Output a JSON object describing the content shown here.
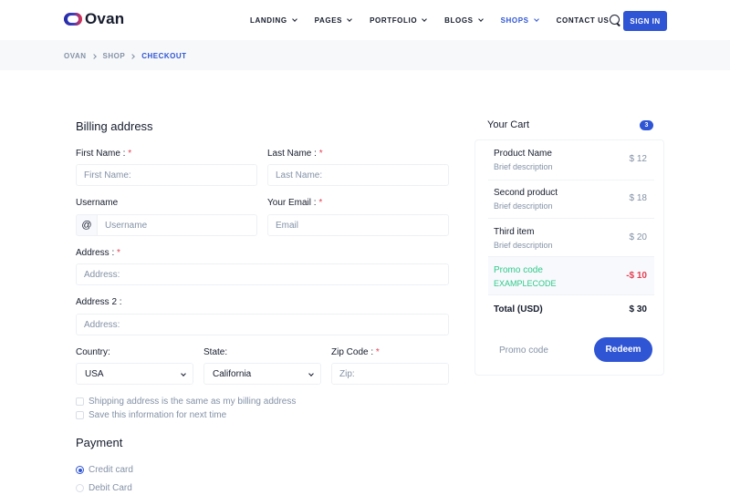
{
  "header": {
    "logo_text": "Ovan",
    "nav": [
      {
        "label": "LANDING",
        "dropdown": true
      },
      {
        "label": "PAGES",
        "dropdown": true
      },
      {
        "label": "PORTFOLIO",
        "dropdown": true
      },
      {
        "label": "BLOGS",
        "dropdown": true
      },
      {
        "label": "SHOPS",
        "dropdown": true,
        "active": true
      },
      {
        "label": "CONTACT US",
        "dropdown": false
      }
    ],
    "signin_label": "SIGN IN"
  },
  "breadcrumb": [
    "OVAN",
    "SHOP",
    "CHECKOUT"
  ],
  "billing": {
    "title": "Billing address",
    "first_name": {
      "label": "First Name :",
      "required": "*",
      "placeholder": "First Name:"
    },
    "last_name": {
      "label": "Last Name :",
      "required": "*",
      "placeholder": "Last Name:"
    },
    "username": {
      "label": "Username",
      "prefix": "@",
      "placeholder": "Username"
    },
    "email": {
      "label": "Your Email :",
      "required": "*",
      "placeholder": "Email"
    },
    "address": {
      "label": "Address :",
      "required": "*",
      "placeholder": "Address:"
    },
    "address2": {
      "label": "Address 2 :",
      "placeholder": "Address:"
    },
    "country": {
      "label": "Country:",
      "value": "USA"
    },
    "state": {
      "label": "State:",
      "value": "California"
    },
    "zip": {
      "label": "Zip Code :",
      "required": "*",
      "placeholder": "Zip:"
    },
    "checkboxes": [
      "Shipping address is the same as my billing address",
      "Save this information for next time"
    ]
  },
  "payment": {
    "title": "Payment",
    "options": [
      {
        "label": "Credit card",
        "selected": true
      },
      {
        "label": "Debit Card",
        "selected": false
      }
    ]
  },
  "cart": {
    "title": "Your Cart",
    "count": "3",
    "items": [
      {
        "name": "Product Name",
        "desc": "Brief description",
        "price": "$ 12"
      },
      {
        "name": "Second product",
        "desc": "Brief description",
        "price": "$ 18"
      },
      {
        "name": "Third item",
        "desc": "Brief description",
        "price": "$ 20"
      }
    ],
    "promo": {
      "name": "Promo code",
      "code": "EXAMPLECODE",
      "amount": "-$ 10"
    },
    "total": {
      "label": "Total (USD)",
      "value": "$ 30"
    },
    "promo_placeholder": "Promo code",
    "redeem_label": "Redeem"
  },
  "colors": {
    "primary": "#2f55d4",
    "success": "#2eca8b",
    "danger": "#e43f52",
    "muted": "#8492a6"
  }
}
